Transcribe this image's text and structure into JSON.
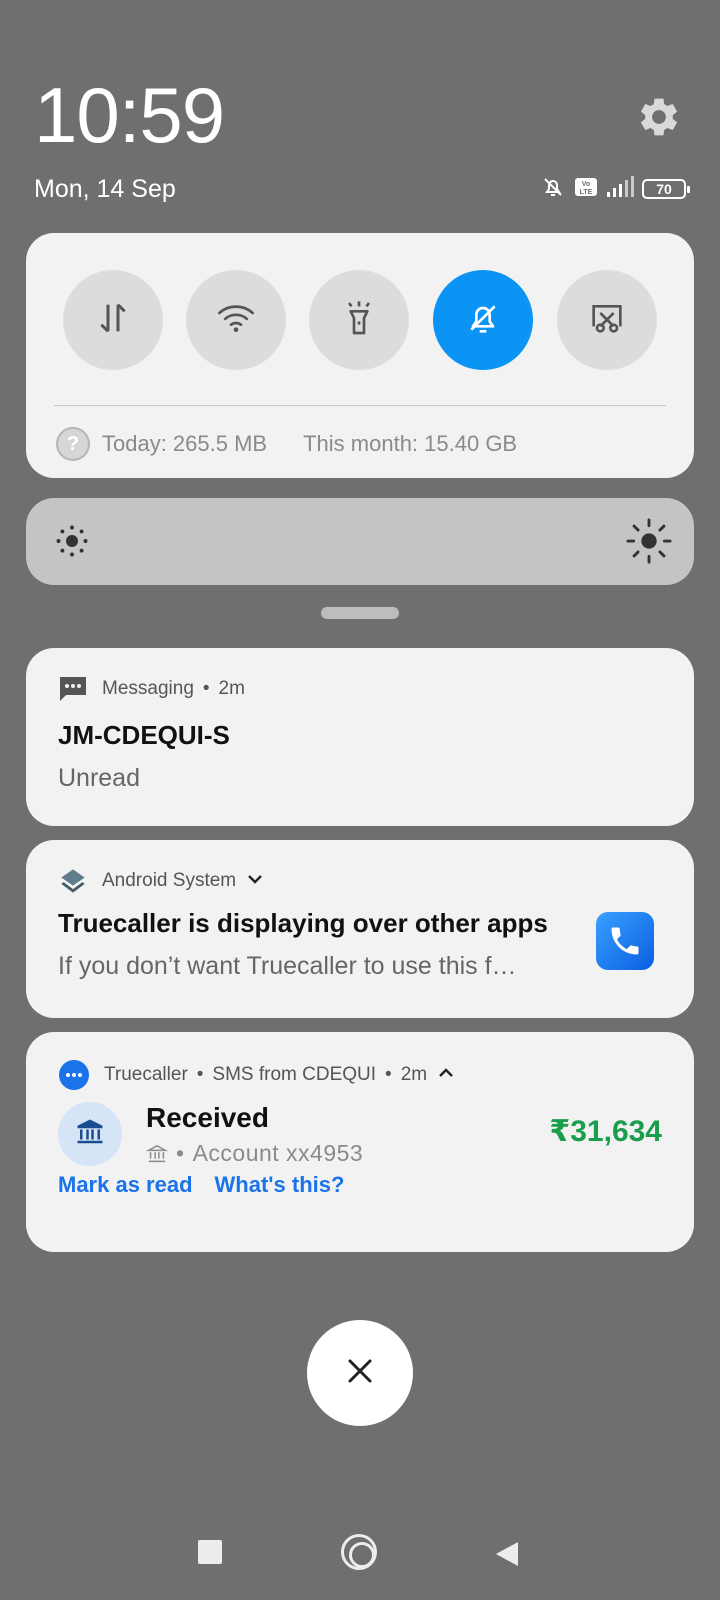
{
  "header": {
    "time": "10:59",
    "date": "Mon, 14 Sep",
    "battery": "70",
    "settings_icon": "gear-icon",
    "status_icons": [
      "dnd-off-icon",
      "volte-icon",
      "signal-icon",
      "battery-icon"
    ]
  },
  "quick_settings": {
    "toggles": [
      {
        "name": "mobile-data",
        "icon": "data-arrows-icon",
        "active": false
      },
      {
        "name": "wifi",
        "icon": "wifi-icon",
        "active": false
      },
      {
        "name": "flashlight",
        "icon": "flashlight-icon",
        "active": false
      },
      {
        "name": "silent",
        "icon": "bell-off-icon",
        "active": true
      },
      {
        "name": "screenshot",
        "icon": "screenshot-icon",
        "active": false
      }
    ],
    "data_usage": {
      "help_glyph": "?",
      "today": "Today: 265.5 MB",
      "month": "This month: 15.40 GB"
    },
    "accent_color": "#0b94f4"
  },
  "notifications": [
    {
      "app": "Messaging",
      "time": "2m",
      "title": "JM-CDEQUI-S",
      "body": "Unread"
    },
    {
      "app": "Android System",
      "title": "Truecaller is displaying over other apps",
      "body": "If you don’t want Truecaller to use this f…"
    },
    {
      "app": "Truecaller",
      "subtext": "SMS from CDEQUI",
      "time": "2m",
      "title": "Received",
      "account": "Account xx4953",
      "amount": "₹31,634",
      "amount_color": "#1a9e4b",
      "actions": [
        "Mark as read",
        "What's this?"
      ]
    }
  ],
  "controls": {
    "clear_all_icon": "close-icon"
  },
  "navbar": {
    "icons": [
      "recents-square-icon",
      "home-circle-icon",
      "back-triangle-icon"
    ]
  }
}
